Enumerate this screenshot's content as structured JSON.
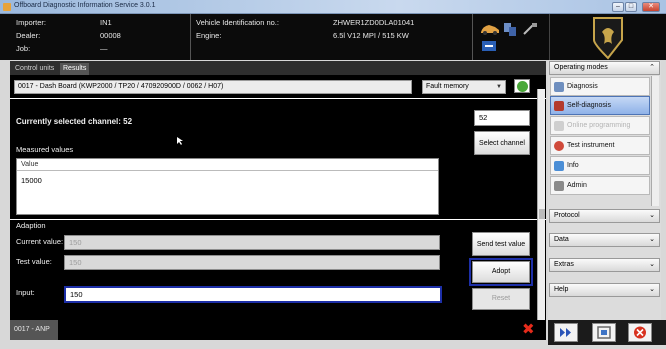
{
  "window": {
    "title": "Offboard Diagnostic Information Service 3.0.1"
  },
  "header": {
    "importer_label": "Importer:",
    "importer_value": "IN1",
    "dealer_label": "Dealer:",
    "dealer_value": "00008",
    "job_label": "Job:",
    "job_value": "—",
    "vin_label": "Vehicle Identification no.:",
    "vin_value": "ZHWER1ZD0DLA01041",
    "engine_label": "Engine:",
    "engine_value": "6.5l V12 MPI / 515 KW"
  },
  "tabs": [
    {
      "label": "Control units"
    },
    {
      "label": "Results"
    }
  ],
  "control_unit": {
    "selected": "0017 - Dash Board  (KWP2000 / TP20 / 470920900D  / 0062 / H07)",
    "memory_select": "Fault memory"
  },
  "channel": {
    "label": "Currently selected channel: 52",
    "input_value": "52",
    "select_button": "Select channel"
  },
  "measured": {
    "section_label": "Measured values",
    "column_header": "Value",
    "value": "15000"
  },
  "adaption": {
    "section_label": "Adaption",
    "current_label": "Current value:",
    "current_value": "150",
    "test_label": "Test value:",
    "test_value": "150",
    "input_label": "Input:",
    "input_value": "150",
    "send_button": "Send test value",
    "adopt_button": "Adopt",
    "reset_button": "Reset"
  },
  "status": {
    "tab_label": "0017 - ANP"
  },
  "sidebar": {
    "operating_modes": "Operating modes",
    "items": [
      {
        "label": "Diagnosis"
      },
      {
        "label": "Self-diagnosis"
      },
      {
        "label": "Online programming"
      },
      {
        "label": "Test instrument"
      },
      {
        "label": "Info"
      },
      {
        "label": "Admin"
      }
    ],
    "protocol": "Protocol",
    "data": "Data",
    "extras": "Extras",
    "help": "Help"
  },
  "colors": {
    "header_bg": "#0b0b0b",
    "main_bg": "#000000",
    "focus_blue": "#1d2fa8",
    "close_red": "#e52b1b",
    "active_item": "#8fb2e8"
  }
}
